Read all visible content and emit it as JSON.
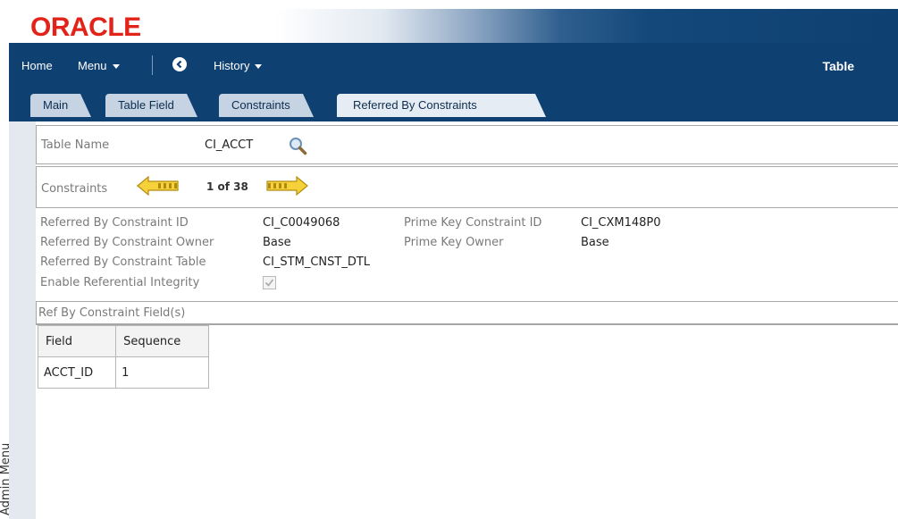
{
  "brand": {
    "logo_text": "ORACLE",
    "logo_color": "#e2231a"
  },
  "nav": {
    "home_label": "Home",
    "menu_label": "Menu",
    "history_label": "History",
    "portal_title": "Table"
  },
  "tabs": [
    {
      "label": "Main",
      "active": false
    },
    {
      "label": "Table Field",
      "active": false
    },
    {
      "label": "Constraints",
      "active": false
    },
    {
      "label": "Referred By Constraints",
      "active": true
    }
  ],
  "side_menu": {
    "label": "Admin Menu"
  },
  "table_name": {
    "label": "Table Name",
    "value": "CI_ACCT"
  },
  "constraints_pager": {
    "label": "Constraints",
    "position_text": "1 of 38"
  },
  "details": {
    "ref_constraint_id_label": "Referred By Constraint ID",
    "ref_constraint_id_value": "CI_C0049068",
    "ref_constraint_owner_label": "Referred By Constraint Owner",
    "ref_constraint_owner_value": "Base",
    "ref_constraint_table_label": "Referred By Constraint Table",
    "ref_constraint_table_value": "CI_STM_CNST_DTL",
    "enable_ri_label": "Enable Referential Integrity",
    "enable_ri_checked": true,
    "prime_key_constraint_id_label": "Prime Key Constraint ID",
    "prime_key_constraint_id_value": "CI_CXM148P0",
    "prime_key_owner_label": "Prime Key Owner",
    "prime_key_owner_value": "Base"
  },
  "fields_section": {
    "title": "Ref By Constraint Field(s)",
    "columns": [
      "Field",
      "Sequence"
    ],
    "rows": [
      {
        "field": "ACCT_ID",
        "sequence": "1"
      }
    ]
  },
  "colors": {
    "header_blue": "#0f4072",
    "tab_bg": "#c5d3e3",
    "active_tab_bg": "#e6ecf3"
  }
}
